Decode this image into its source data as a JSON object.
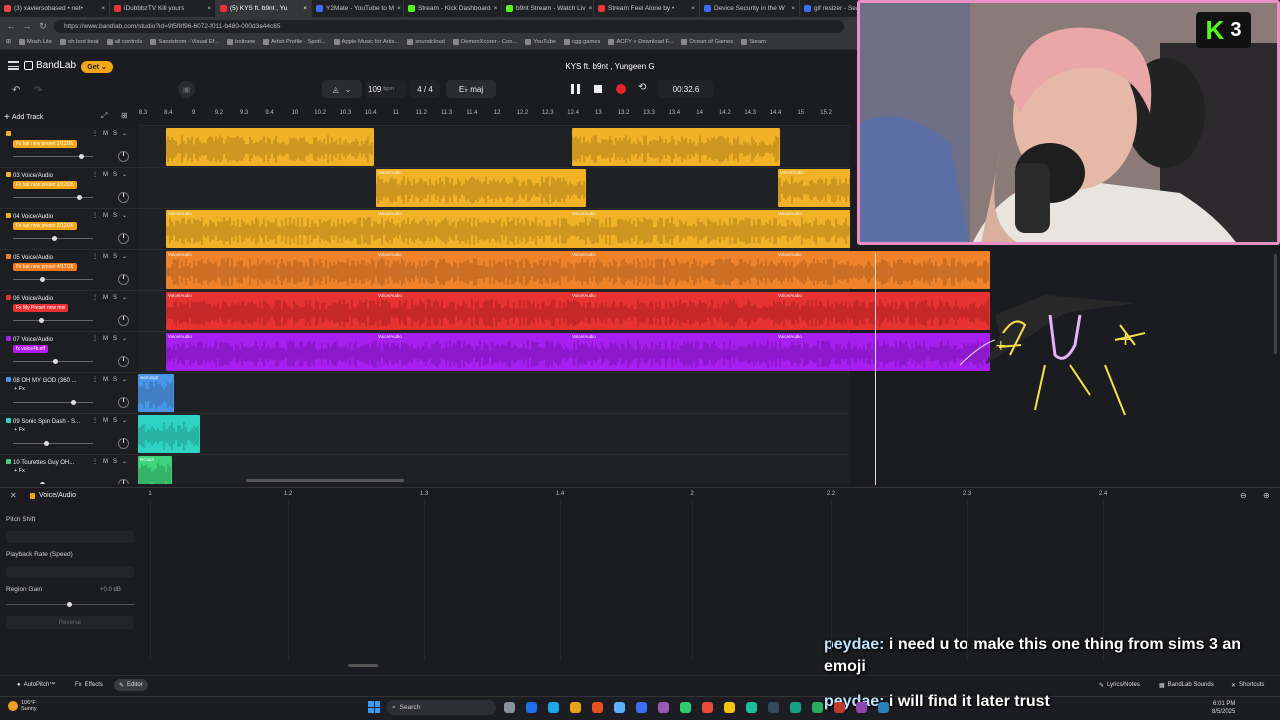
{
  "browser": {
    "tabs": [
      {
        "label": "(3) xaviersobased • net•",
        "color": "#e44"
      },
      {
        "label": "iDubbbzTV Kill yours",
        "color": "#e33"
      },
      {
        "label": "(5) KYS ft. b9nt , Yu",
        "color": "#e33",
        "active": true
      },
      {
        "label": "Y2Mate - YouTube to M",
        "color": "#3b6ef2"
      },
      {
        "label": "Stream - Kick Dashboard",
        "color": "#53fc18"
      },
      {
        "label": "b9nt Stream - Watch Liv",
        "color": "#53fc18"
      },
      {
        "label": "Stream Feel Alone by •",
        "color": "#e33"
      },
      {
        "label": "Device Security in the W",
        "color": "#3b6ef2"
      },
      {
        "label": "gif resizer - Search",
        "color": "#3b6ef2"
      }
    ],
    "url": "https://www.bandlab.com/studio?id=9f5f8f96-6072-f011-b480-000d3a44c65",
    "bookmarks": [
      "Mosh Lite",
      "oh lord beat",
      "all controls",
      "Sandstrom - Visual Ef...",
      "boltnew",
      "Artist Profile · Spoti...",
      "Apple Music for Artis...",
      "soundcloud",
      "DemonXcorer - Con...",
      "YouTube",
      "cgg games",
      "ACFY » Download F...",
      "Ocean of Games",
      "Steam"
    ]
  },
  "app": {
    "logo": "BandLab",
    "get_label": "Get",
    "song_title": "KYS ft. b9nt , Yungeen G",
    "tempo": "109",
    "tempo_unit": "bpm",
    "time_sig": "4 / 4",
    "key": "E♭ maj",
    "time": "00:32.6",
    "add_track": "Add Track",
    "ruler_ticks": [
      "8.3",
      "8.4",
      "9",
      "9.2",
      "9.3",
      "9.4",
      "10",
      "10.2",
      "10.3",
      "10.4",
      "11",
      "11.2",
      "11.3",
      "11.4",
      "12",
      "12.2",
      "12.3",
      "12.4",
      "13",
      "13.2",
      "13.3",
      "13.4",
      "14",
      "14.2",
      "14.3",
      "14.4",
      "15",
      "15.2"
    ]
  },
  "tracks": [
    {
      "num": "",
      "name": "",
      "preset": "Fx kat new preset 2/12/26",
      "preset_color": "#f2a619",
      "color": "#f2b227",
      "vol": 0.84
    },
    {
      "num": "03",
      "name": "Voice/Audio",
      "preset": "Fx kat new preset 2/12/26",
      "preset_color": "#f2a619",
      "color": "#f2b227",
      "vol": 0.82
    },
    {
      "num": "04",
      "name": "Voice/Audio",
      "preset": "Fx kat new preset 2/12/26",
      "preset_color": "#f2a619",
      "color": "#f2b227",
      "vol": 0.5
    },
    {
      "num": "05",
      "name": "Voice/Audio",
      "preset": "Fx kat new preset 4/17/26",
      "preset_color": "#f07b18",
      "color": "#f0822a",
      "vol": 0.35
    },
    {
      "num": "06",
      "name": "Voice/Audio",
      "preset": "Fx My Preset new mix",
      "preset_color": "#e83030",
      "color": "#e83131",
      "vol": 0.33
    },
    {
      "num": "07",
      "name": "Voice/Audio",
      "preset": "fx voice4k.eff",
      "preset_color": "#b01cf0",
      "color": "#a71ef0",
      "vol": 0.51
    },
    {
      "num": "08",
      "name": "OH MY GOD (360 ...",
      "fx": "+ Fx",
      "color": "#4b95e8",
      "vol": 0.74
    },
    {
      "num": "09",
      "name": "Sonic Spin Dash - S...",
      "fx": "+ Fx",
      "color": "#2fd3c3",
      "vol": 0.4
    },
    {
      "num": "10",
      "name": "Tourettes Guy  OH...",
      "fx": "+ Fx",
      "color": "#3fd37b",
      "vol": 0.35
    }
  ],
  "clip_label": "Voice/Audio",
  "clip_labels_small": [
    "warning2",
    "",
    "RCap3"
  ],
  "editor": {
    "title": "Voice/Audio",
    "pitch_shift": "Pitch Shift",
    "playback_rate": "Playback Rate (Speed)",
    "region_gain": "Region Gain",
    "gain_value": "+0.0 dB",
    "gain_level": 0.5,
    "reverse": "Reverse",
    "ruler_ticks": [
      "1",
      "1.2",
      "1.3",
      "1.4",
      "2",
      "2.2",
      "2.3",
      "2.4"
    ]
  },
  "bottom_bar": {
    "autopitch": "AutoPitch™",
    "effects": "Effects",
    "editor": "Editor",
    "lyrics": "Lyrics/Notes",
    "sounds": "BandLab Sounds",
    "shortcuts": "Shortcuts"
  },
  "taskbar": {
    "temp": "106°F",
    "weather": "Sunny",
    "search": "Search",
    "time": "6:01 PM",
    "date": "8/5/2025"
  },
  "stream": {
    "viewer_count": "3",
    "platform_letter": "K"
  },
  "chat": [
    {
      "user": "peydae:",
      "message": "i need u to make this one thing from sims 3 an emoji"
    },
    {
      "user": "peydae:",
      "message": "i will find it later trust"
    }
  ]
}
